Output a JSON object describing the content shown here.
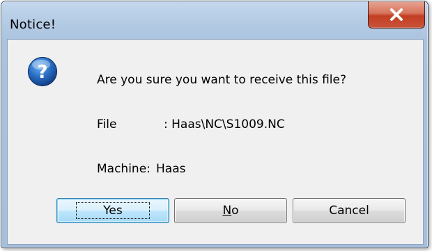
{
  "window": {
    "title": "Notice!",
    "close_icon": "close-icon"
  },
  "dialog": {
    "icon": "question-icon",
    "message": "Are you sure you want to receive this file?",
    "file_label": "File",
    "file_value": ": Haas\\NC\\S1009.NC",
    "machine_label": "Machine:",
    "machine_value": "Haas"
  },
  "buttons": {
    "yes_label": "Yes",
    "no_mnemonic": "N",
    "no_rest": "o",
    "cancel_label": "Cancel"
  },
  "colors": {
    "title_bar": "#b4cbe4",
    "close_button": "#c23e22",
    "default_button": "#bee6fd",
    "icon_blue": "#1e5fb4"
  }
}
